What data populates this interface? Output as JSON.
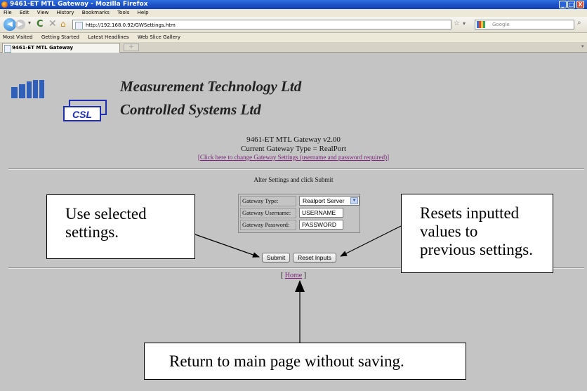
{
  "window": {
    "title": "9461-ET MTL Gateway - Mozilla Firefox",
    "minimize": "_",
    "maximize": "□",
    "close": "X"
  },
  "menu": [
    "File",
    "Edit",
    "View",
    "History",
    "Bookmarks",
    "Tools",
    "Help"
  ],
  "nav": {
    "url": "http://192.168.0.92/GWSettings.htm",
    "search_placeholder": "Google"
  },
  "bookmarks": [
    "Most Visited",
    "Getting Started",
    "Latest Headlines",
    "Web Slice Gallery"
  ],
  "tab": {
    "label": "9461-ET MTL Gateway",
    "new_tab": "+"
  },
  "page": {
    "mtl_logo": "MTL",
    "csl_logo": "CSL",
    "company1": "Measurement Technology Ltd",
    "company2": "Controlled Systems Ltd",
    "gateway_title": "9461-ET MTL Gateway v2.00",
    "gateway_type": "Current Gateway Type = RealPort",
    "change_link_prefix": "[",
    "change_link": "Click here to change Gateway Settings (username and password required)",
    "change_link_suffix": "]",
    "alter_text": "Alter Settings and click Submit",
    "form": {
      "type_label": "Gateway Type:",
      "type_value": "Realport Server",
      "username_label": "Gateway Username:",
      "username_value": "USERNAME",
      "password_label": "Gateway Password:",
      "password_value": "PASSWORD"
    },
    "submit": "Submit",
    "reset": "Reset Inputs",
    "home_prefix": "[ ",
    "home": "Home",
    "home_suffix": " ]"
  },
  "annotations": {
    "a1_line1": "Use selected",
    "a1_line2": "settings.",
    "a2_line1": "Resets inputted",
    "a2_line2": "values to",
    "a2_line3": "previous settings.",
    "a3": "Return to main page without saving."
  }
}
